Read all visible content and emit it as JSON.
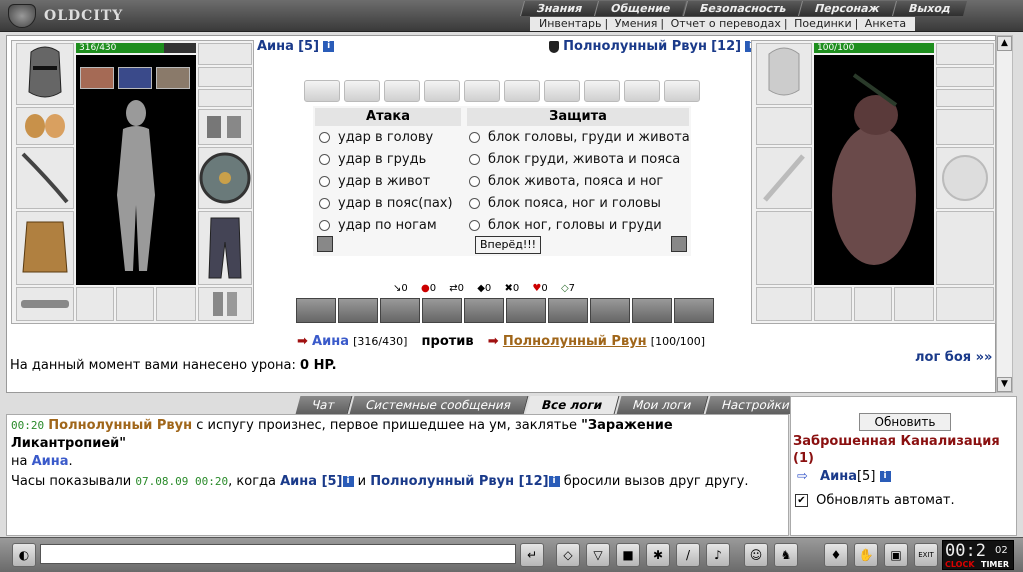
{
  "app": {
    "logo_text": "OLDCITY"
  },
  "menu_top": [
    "Знания",
    "Общение",
    "Безопасность",
    "Персонаж",
    "Выход"
  ],
  "menu_sub": [
    "Инвентарь",
    "Умения",
    "Отчет о переводах",
    "Поединки",
    "Анкета"
  ],
  "player": {
    "name": "Аина",
    "level": "[5]",
    "hp": "316/430",
    "hp_fraction": 0.735
  },
  "enemy": {
    "name": "Полнолунный Рвун",
    "level": "[12]",
    "hp": "100/100",
    "hp_fraction": 1.0
  },
  "attack": {
    "header": "Атака",
    "options": [
      "удар в голову",
      "удар в грудь",
      "удар в живот",
      "удар в пояс(пах)",
      "удар по ногам"
    ]
  },
  "defense": {
    "header": "Защита",
    "options": [
      "блок головы, груди и живота",
      "блок груди, живота и пояса",
      "блок живота, пояса и ног",
      "блок пояса, ног и головы",
      "блок ног, головы и груди"
    ]
  },
  "forward_button": "Вперёд!!!",
  "stats": [
    "0",
    "0",
    "0",
    "0",
    "0",
    "0",
    "7"
  ],
  "versus": {
    "p_name": "Аина",
    "p_hp": "[316/430]",
    "vs": "против",
    "e_name": "Полнолунный Рвун",
    "e_hp": "[100/100]"
  },
  "damage": {
    "prefix": "На данный момент вами нанесено урона:",
    "value": "0 HP."
  },
  "battle_log_link": "лог боя »»",
  "tabs": [
    "Чат",
    "Системные сообщения",
    "Все логи",
    "Мои логи",
    "Настройки"
  ],
  "log": {
    "line1_time": "00:20",
    "line1_name": "Полнолунный Рвун",
    "line1_text": "с испугу произнес, первое пришедшее на ум, заклятье",
    "line1_spell": "\"Заражение Ликантропией\"",
    "line1_na": "на",
    "line1_target": "Аина",
    "line2_prefix": "Часы показывали",
    "line2_time": "07.08.09 00:20",
    "line2_when": ", когда",
    "line2_p": "Аина [5]",
    "line2_and": "и",
    "line2_e": "Полнолунный Рвун [12]",
    "line2_suffix": "бросили вызов друг другу."
  },
  "side": {
    "refresh_button": "Обновить",
    "location": "Заброшенная Канализация (1)",
    "user_name": "Аина",
    "user_level": "[5]",
    "auto_refresh_label": "Обновлять автомат."
  },
  "clock": {
    "time": "00:2",
    "sub": "02",
    "clock_label": "CLOCK",
    "timer_label": "TIMER",
    "exit_label": "EXIT"
  },
  "colors": {
    "accent_blue": "#1a3a8a",
    "enemy_brown": "#a0661a",
    "location_red": "#8a1010",
    "hp_green": "#1e8e1e"
  }
}
